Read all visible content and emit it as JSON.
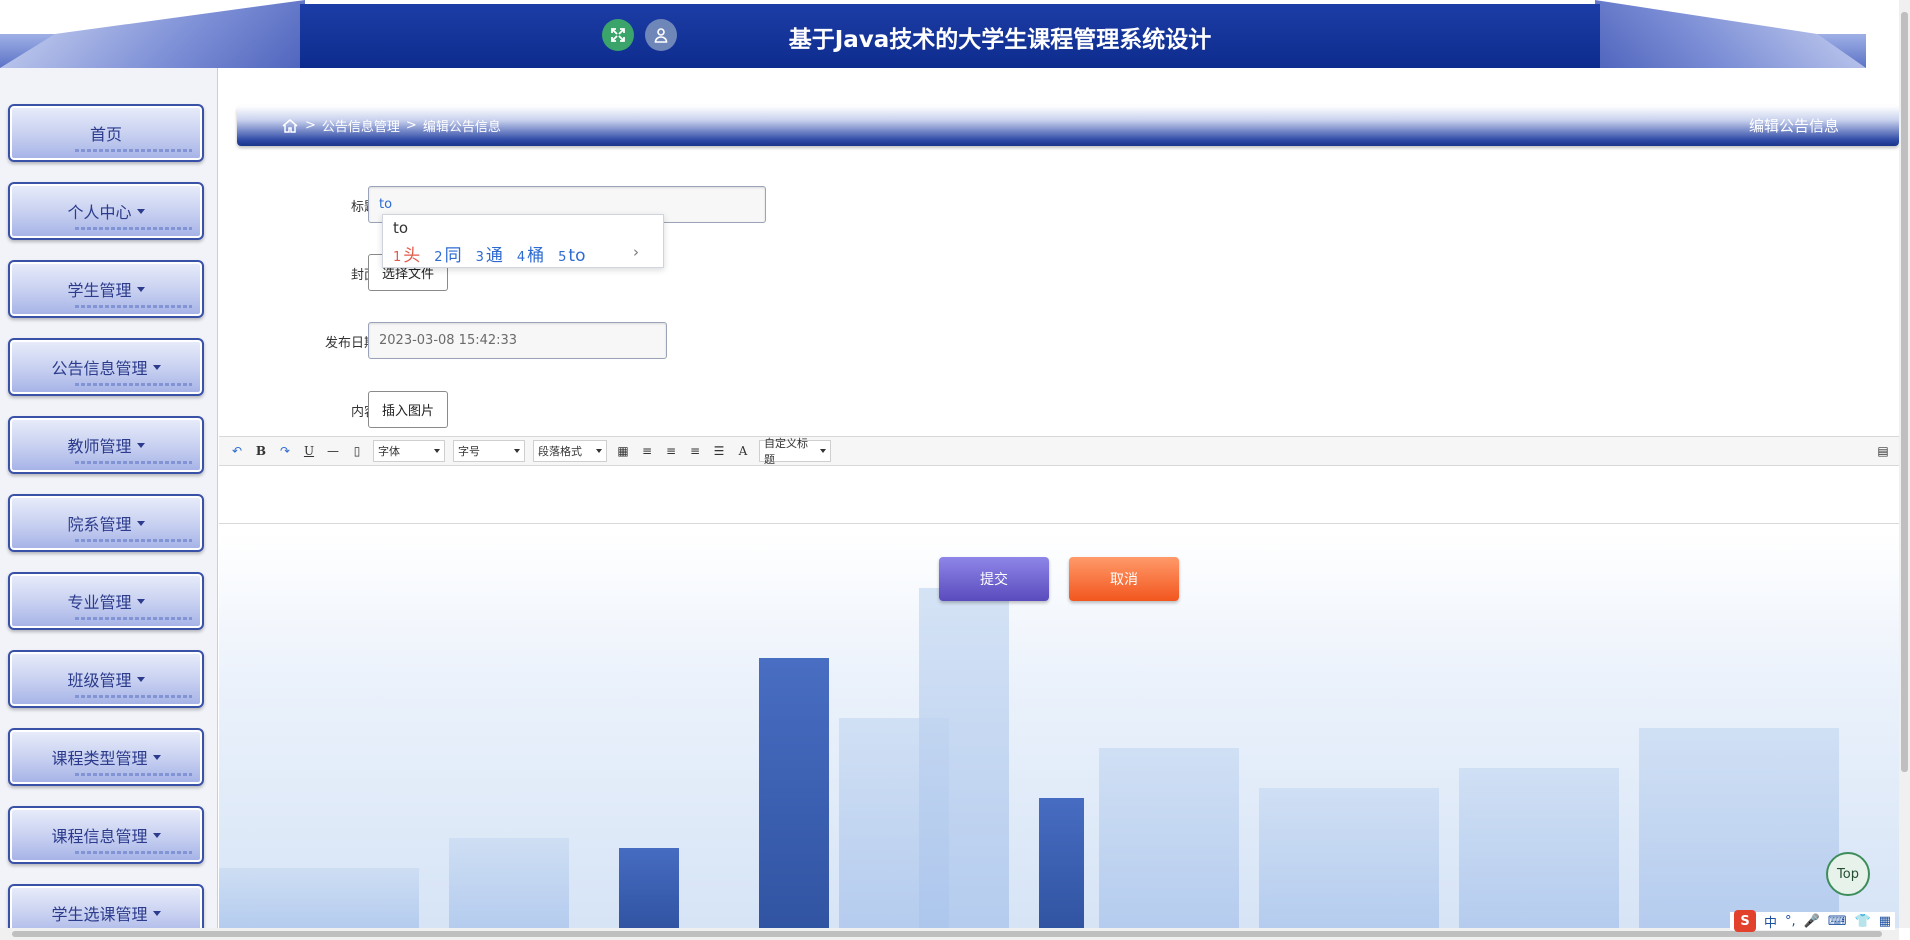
{
  "header": {
    "title": "基于Java技术的大学生课程管理系统设计",
    "fullscreen_icon": "expand-icon",
    "user_icon": "user-icon"
  },
  "sidebar": {
    "items": [
      {
        "label": "首页",
        "has_caret": false
      },
      {
        "label": "个人中心",
        "has_caret": true
      },
      {
        "label": "学生管理",
        "has_caret": true
      },
      {
        "label": "公告信息管理",
        "has_caret": true
      },
      {
        "label": "教师管理",
        "has_caret": true
      },
      {
        "label": "院系管理",
        "has_caret": true
      },
      {
        "label": "专业管理",
        "has_caret": true
      },
      {
        "label": "班级管理",
        "has_caret": true
      },
      {
        "label": "课程类型管理",
        "has_caret": true
      },
      {
        "label": "课程信息管理",
        "has_caret": true
      },
      {
        "label": "学生选课管理",
        "has_caret": true
      }
    ]
  },
  "breadcrumb": {
    "sep": ">",
    "level1": "公告信息管理",
    "level2": "编辑公告信息"
  },
  "page_heading": "编辑公告信息",
  "form": {
    "title_label": "标题",
    "title_value": "to",
    "cover_label": "封面",
    "cover_button": "选择文件",
    "date_label": "发布日期",
    "date_value": "2023-03-08 15:42:33",
    "content_label": "内容",
    "insert_image_button": "插入图片"
  },
  "ime": {
    "composing": "to",
    "candidates": [
      {
        "n": "1",
        "text": "头"
      },
      {
        "n": "2",
        "text": "同"
      },
      {
        "n": "3",
        "text": "通"
      },
      {
        "n": "4",
        "text": "桶"
      },
      {
        "n": "5",
        "text": "to"
      }
    ],
    "next": "›"
  },
  "editor": {
    "font_select": "字体",
    "size_select": "字号",
    "paragraph_select": "段落格式",
    "custom_title_select": "自定义标题"
  },
  "actions": {
    "submit": "提交",
    "cancel": "取消"
  },
  "top_button": "Top",
  "tray": {
    "logo": "S",
    "lang": "中"
  },
  "colors": {
    "header_bg": "#0e2c8e",
    "submit": "#5a4bbd",
    "cancel": "#f2561e"
  }
}
